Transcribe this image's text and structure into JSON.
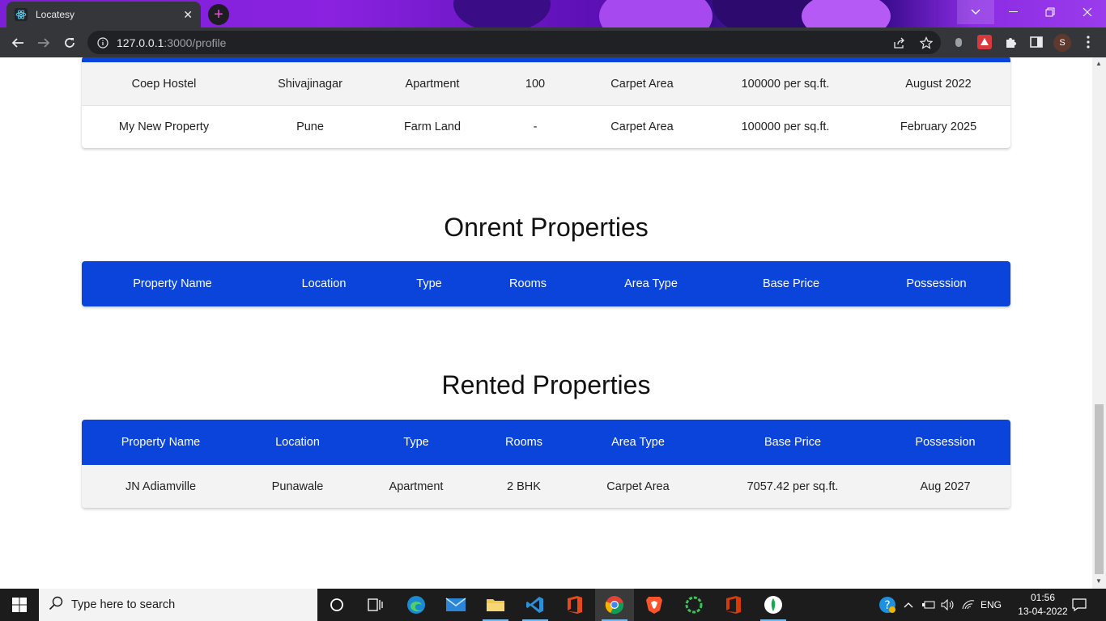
{
  "browser": {
    "tab_title": "Locatesy",
    "tab_close": "✕",
    "new_tab": "+",
    "url_host": "127.0.0.1",
    "url_path": ":3000/profile",
    "profile_initial": "S"
  },
  "owned_table": {
    "rows": [
      [
        "Coep Hostel",
        "Shivajinagar",
        "Apartment",
        "100",
        "Carpet Area",
        "100000 per sq.ft.",
        "August 2022"
      ],
      [
        "My New Property",
        "Pune",
        "Farm Land",
        "-",
        "Carpet Area",
        "100000 per sq.ft.",
        "February 2025"
      ]
    ]
  },
  "onrent": {
    "title": "Onrent Properties",
    "headers": [
      "Property Name",
      "Location",
      "Type",
      "Rooms",
      "Area Type",
      "Base Price",
      "Possession"
    ]
  },
  "rented": {
    "title": "Rented Properties",
    "headers": [
      "Property Name",
      "Location",
      "Type",
      "Rooms",
      "Area Type",
      "Base Price",
      "Possession"
    ],
    "rows": [
      [
        "JN Adiamville",
        "Punawale",
        "Apartment",
        "2 BHK",
        "Carpet Area",
        "7057.42 per sq.ft.",
        "Aug 2027"
      ]
    ]
  },
  "taskbar": {
    "search_placeholder": "Type here to search",
    "language": "ENG",
    "time": "01:56",
    "date": "13-04-2022"
  },
  "colors": {
    "header_blue": "#0b44da",
    "tab_bg": "#35363a"
  }
}
